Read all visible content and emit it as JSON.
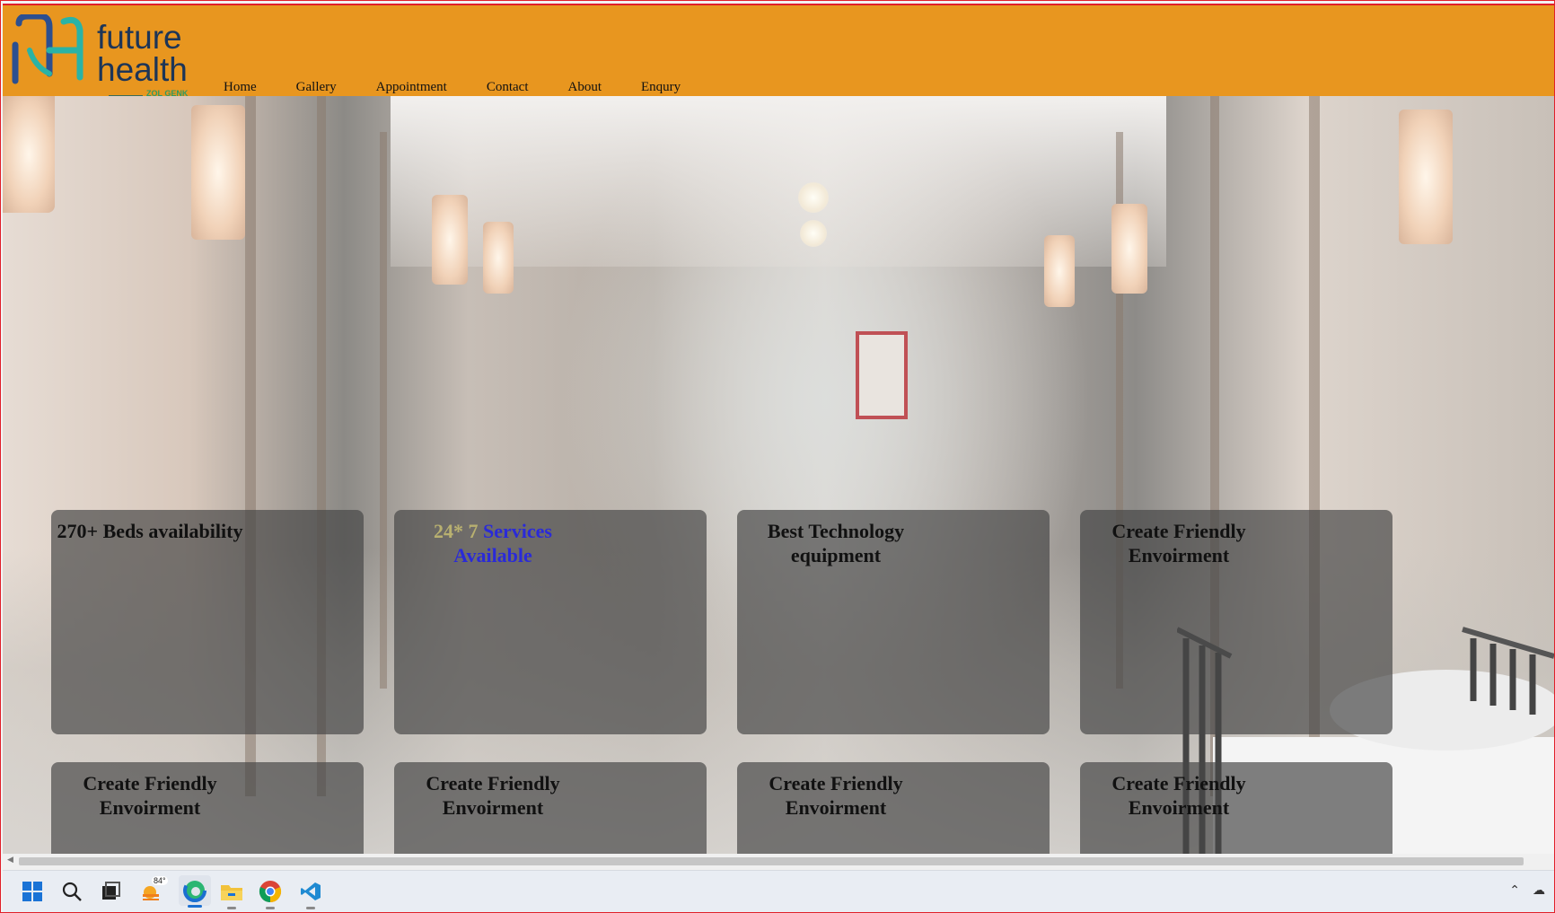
{
  "brand": {
    "name_line1": "future",
    "name_line2": "health",
    "tagline": "ZOL GENK",
    "accent_color": "#e8961f",
    "logo_colors": [
      "#2c3e8f",
      "#2ab3a6",
      "#6aa84f"
    ]
  },
  "nav": {
    "items": [
      "Home",
      "Gallery",
      "Appointment",
      "Contact",
      "About",
      "Enqury"
    ]
  },
  "cards": {
    "row1": [
      {
        "title": "270+ Beds availability"
      },
      {
        "title_part1": "24* 7",
        "title_part2": "Services Available"
      },
      {
        "title": "Best Technology equipment"
      },
      {
        "title": "Create Friendly Envoirment"
      }
    ],
    "row2": [
      {
        "title": "Create Friendly Envoirment"
      },
      {
        "title": "Create Friendly Envoirment"
      },
      {
        "title": "Create Friendly Envoirment"
      },
      {
        "title": "Create Friendly Envoirment"
      }
    ]
  },
  "taskbar": {
    "weather_temp": "84°",
    "icons": [
      "windows-start-icon",
      "search-icon",
      "task-view-icon",
      "weather-icon",
      "edge-browser-icon",
      "file-explorer-icon",
      "chrome-icon",
      "vscode-icon"
    ],
    "tray": [
      "chevron-up-icon",
      "cloud-icon"
    ]
  }
}
